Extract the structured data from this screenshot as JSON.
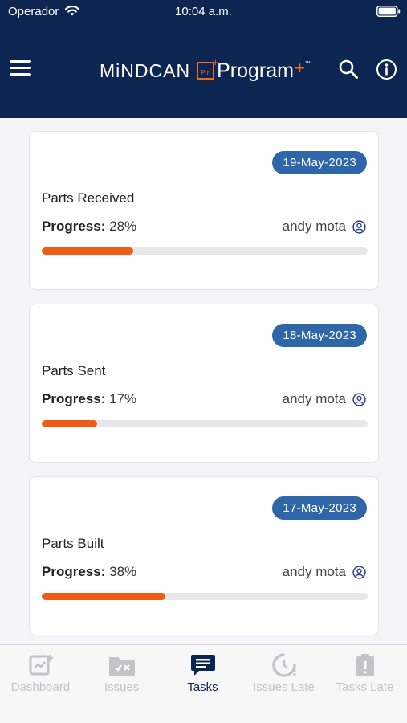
{
  "status": {
    "carrier": "Operador",
    "time": "10:04 a.m."
  },
  "header": {
    "brand_main": "MiNDCAN",
    "brand_pm": "Pm",
    "brand_program": "Program",
    "brand_plus": "+",
    "brand_tm": "™"
  },
  "tasks": [
    {
      "date": "19-May-2023",
      "title": "Parts Received",
      "progress_label": "Progress:",
      "progress_value": "28%",
      "progress_fraction": 0.28,
      "assignee": "andy mota"
    },
    {
      "date": "18-May-2023",
      "title": "Parts Sent",
      "progress_label": "Progress:",
      "progress_value": "17%",
      "progress_fraction": 0.17,
      "assignee": "andy mota"
    },
    {
      "date": "17-May-2023",
      "title": "Parts Built",
      "progress_label": "Progress:",
      "progress_value": "38%",
      "progress_fraction": 0.38,
      "assignee": "andy mota"
    }
  ],
  "tabs": [
    {
      "label": "Dashboard",
      "icon": "dashboard-icon",
      "active": false
    },
    {
      "label": "Issues",
      "icon": "issues-icon",
      "active": false
    },
    {
      "label": "Tasks",
      "icon": "tasks-icon",
      "active": true
    },
    {
      "label": "Issues Late",
      "icon": "issues-late-icon",
      "active": false
    },
    {
      "label": "Tasks Late",
      "icon": "tasks-late-icon",
      "active": false
    }
  ],
  "colors": {
    "navy": "#0d2551",
    "accent_orange": "#ef5a14",
    "badge_blue": "#2e66a8",
    "inactive_tab": "#c4c4c7"
  }
}
